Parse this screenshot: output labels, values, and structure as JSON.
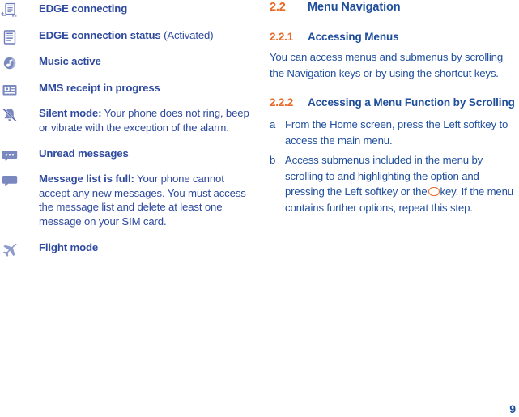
{
  "page": {
    "number": "9",
    "colors": {
      "accent_orange": "#EA6826",
      "heading_blue": "#1F4E9C",
      "left_text_blue": "#2E4A9E",
      "icon_blue": "#7A88C0",
      "background": "#FFFFFF"
    }
  },
  "status_list": {
    "items": [
      {
        "icon": "edge-connecting-icon",
        "label": "EDGE connecting",
        "rest": ""
      },
      {
        "icon": "edge-connection-status-icon",
        "label": "EDGE connection status",
        "rest": " (Activated)"
      },
      {
        "icon": "music-active-icon",
        "label": "Music active",
        "rest": ""
      },
      {
        "icon": "mms-receipt-icon",
        "label": "MMS receipt in progress",
        "rest": ""
      },
      {
        "icon": "silent-mode-icon",
        "label": "Silent mode:",
        "rest": " Your phone does not ring, beep or vibrate with the exception of the alarm."
      },
      {
        "icon": "unread-messages-icon",
        "label": "Unread messages",
        "rest": ""
      },
      {
        "icon": "message-list-full-icon",
        "label": "Message list is full:",
        "rest": " Your phone cannot accept any new messages. You must access the message list and delete at least one message on your SIM card."
      },
      {
        "icon": "flight-mode-icon",
        "label": "Flight mode",
        "rest": ""
      }
    ]
  },
  "section": {
    "h2": {
      "number": "2.2",
      "title": "Menu Navigation"
    },
    "h3_accessing_menus": {
      "number": "2.2.1",
      "title": "Accessing Menus",
      "body": "You can access menus and submenus by scrolling the Navigation keys or by using the shortcut keys."
    },
    "h3_accessing_function": {
      "number": "2.2.2",
      "title": "Accessing a Menu Function by Scrolling",
      "steps": [
        {
          "marker": "a",
          "text": "From the Home screen, press the Left softkey to access the main menu."
        },
        {
          "marker": "b",
          "text_before_key": "Access submenus included in the menu by scrolling to and highlighting the option and pressing the Left softkey or the",
          "key_glyph": "ok-key-icon",
          "text_after_key": "key. If the menu contains further options, repeat this step."
        }
      ]
    }
  }
}
